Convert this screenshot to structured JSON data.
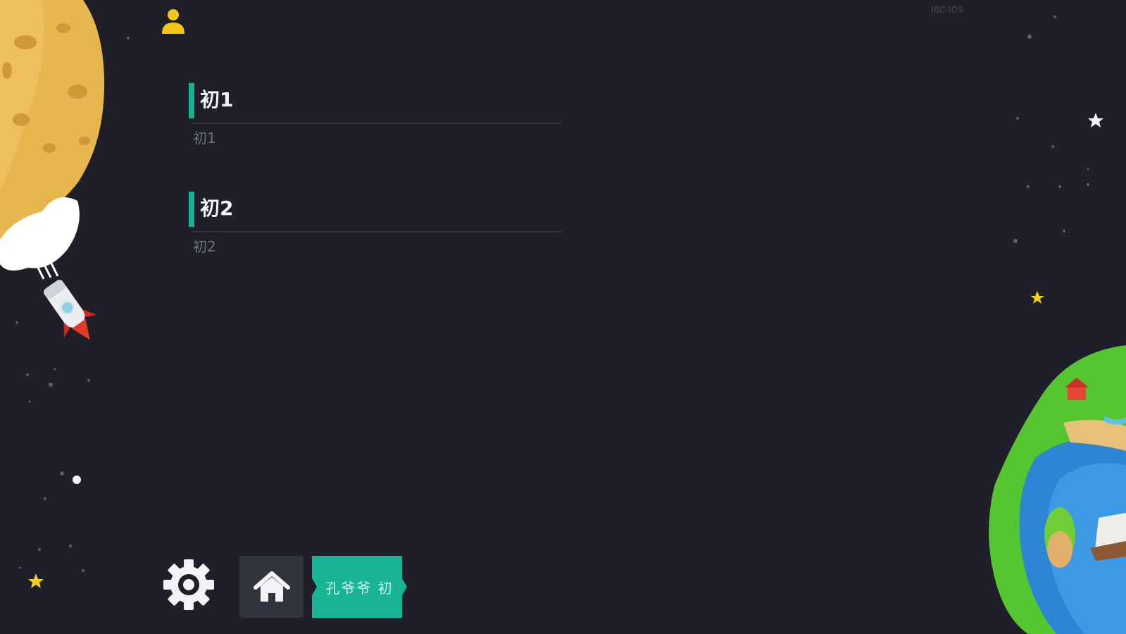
{
  "header": {
    "version_text": "IBC-IOS"
  },
  "lessons": [
    {
      "title": "初1",
      "subtitle": "初1"
    },
    {
      "title": "初2",
      "subtitle": "初2"
    }
  ],
  "toolbar": {
    "student_label": "孔爷爷 初"
  },
  "colors": {
    "background": "#1e1f29",
    "accent": "#19b495",
    "user_icon": "#f6c615",
    "title_text": "#f3f4f7",
    "subtitle_text": "#6e7180"
  },
  "icons": {
    "user": "user-icon",
    "settings": "gear-icon",
    "home": "home-icon"
  }
}
